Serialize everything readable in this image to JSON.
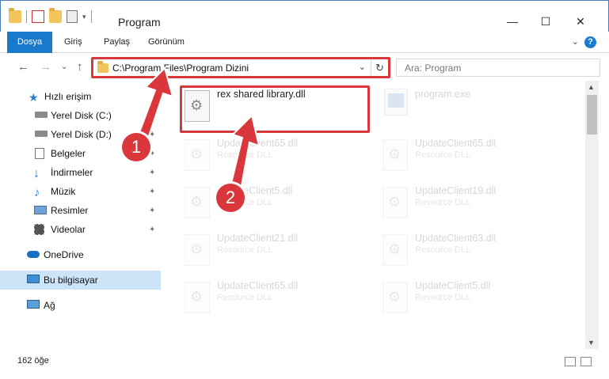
{
  "window": {
    "title": "Program",
    "controls": {
      "minimize": "—",
      "maximize": "☐",
      "close": "✕"
    }
  },
  "ribbon": {
    "tabs": [
      "Dosya",
      "Giriş",
      "Paylaş",
      "Görünüm"
    ],
    "expand_glyph": "⌄",
    "help_glyph": "?"
  },
  "nav": {
    "back": "←",
    "forward": "→",
    "recent": "⌄",
    "up": "↑",
    "address_path": "C:\\Program Files\\Program Dizini",
    "dropdown": "⌄",
    "refresh": "↻",
    "search_placeholder": "Ara: Program"
  },
  "sidebar": {
    "items": [
      {
        "label": "Hızlı erişim",
        "icon": "star-icon"
      },
      {
        "label": "Yerel Disk (C:)",
        "icon": "drive-icon",
        "pinned": true
      },
      {
        "label": "Yerel Disk (D:)",
        "icon": "drive-icon",
        "pinned": true
      },
      {
        "label": "Belgeler",
        "icon": "documents-icon",
        "pinned": true
      },
      {
        "label": "İndirmeler",
        "icon": "downloads-icon",
        "pinned": true
      },
      {
        "label": "Müzik",
        "icon": "music-icon",
        "pinned": true
      },
      {
        "label": "Resimler",
        "icon": "pictures-icon",
        "pinned": true
      },
      {
        "label": "Videolar",
        "icon": "videos-icon",
        "pinned": true
      },
      {
        "label": "OneDrive",
        "icon": "cloud-icon"
      },
      {
        "label": "Bu bilgisayar",
        "icon": "computer-icon",
        "selected": true
      },
      {
        "label": "Ağ",
        "icon": "network-icon"
      }
    ],
    "pin_glyph": "📌"
  },
  "files": [
    {
      "name": "rex shared library.dll",
      "type": "",
      "highlighted": true
    },
    {
      "name": "program.exe",
      "type": "",
      "faded": true
    },
    {
      "name": "UpdateClient65.dll",
      "type": "Resource DLL",
      "faded": true
    },
    {
      "name": "UpdateClient65.dll",
      "type": "Resource DLL",
      "faded": true
    },
    {
      "name": "UpdateClient5.dll",
      "type": "Resource DLL",
      "faded": true
    },
    {
      "name": "UpdateClient19.dll",
      "type": "Resource DLL",
      "faded": true
    },
    {
      "name": "UpdateClient21.dll",
      "type": "Resource DLL",
      "faded": true
    },
    {
      "name": "UpdateClient63.dll",
      "type": "Resource DLL",
      "faded": true
    },
    {
      "name": "UpdateClient65.dll",
      "type": "Resource DLL",
      "faded": true
    },
    {
      "name": "UpdateClient5.dll",
      "type": "Resource DLL",
      "faded": true
    }
  ],
  "status": {
    "item_count": "162 öğe"
  },
  "annotations": {
    "step1": "1",
    "step2": "2",
    "color": "#d9373c"
  },
  "colors": {
    "accent": "#1979ca",
    "selection": "#cce4f7"
  }
}
